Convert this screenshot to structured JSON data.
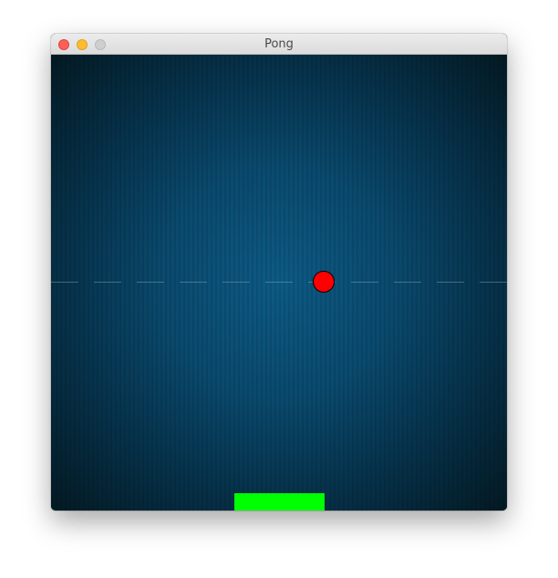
{
  "window": {
    "title": "Pong",
    "buttons": {
      "close": "close-button",
      "minimize": "minimize-button",
      "zoom": "zoom-button"
    }
  },
  "game": {
    "ball": {
      "color": "#ff0000",
      "outline": "#000000"
    },
    "paddle": {
      "color": "#00ff00"
    },
    "background": {
      "center": "#0d5a85",
      "edge": "#031820"
    },
    "center_line": "dashed"
  }
}
